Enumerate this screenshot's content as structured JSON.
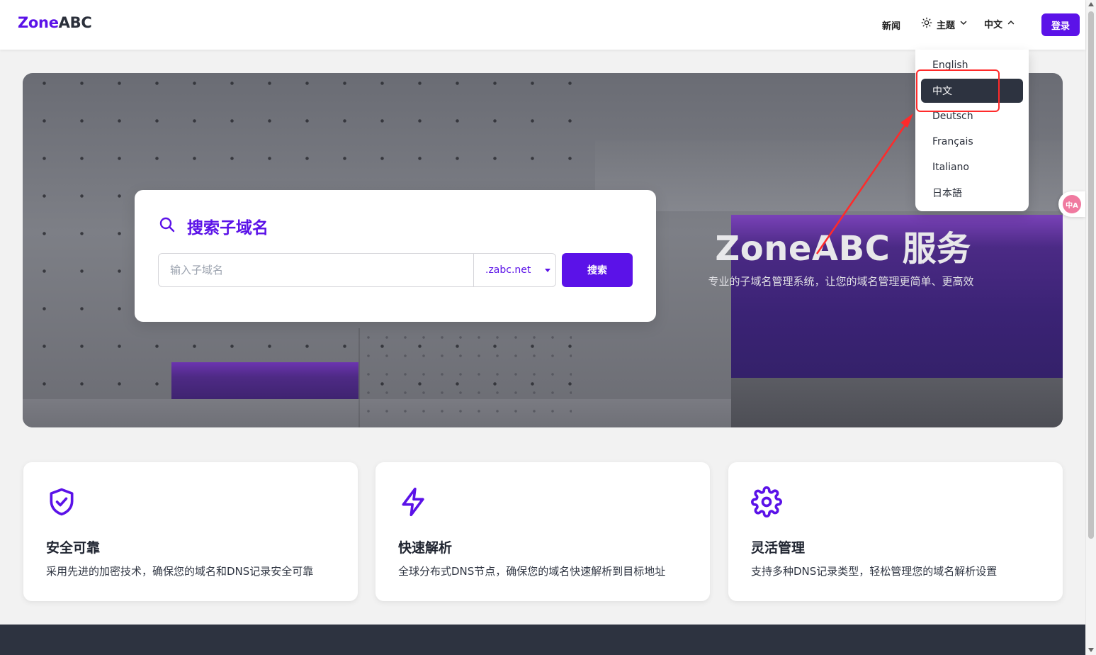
{
  "header": {
    "logo_zone": "Zone",
    "logo_abc": "ABC",
    "news": "新闻",
    "theme": "主题",
    "language": "中文",
    "login": "登录"
  },
  "language_menu": {
    "items": [
      "English",
      "中文",
      "Deutsch",
      "Français",
      "Italiano",
      "日本語"
    ],
    "selected": "中文"
  },
  "hero": {
    "title": "ZoneABC 服务",
    "subtitle": "专业的子域名管理系统，让您的域名管理更简单、更高效"
  },
  "search": {
    "title": "搜索子域名",
    "placeholder": "输入子域名",
    "domain": ".zabc.net",
    "button": "搜索"
  },
  "features": [
    {
      "icon": "shield-check-icon",
      "title": "安全可靠",
      "desc": "采用先进的加密技术，确保您的域名和DNS记录安全可靠"
    },
    {
      "icon": "lightning-icon",
      "title": "快速解析",
      "desc": "全球分布式DNS节点，确保您的域名快速解析到目标地址"
    },
    {
      "icon": "gear-icon",
      "title": "灵活管理",
      "desc": "支持多种DNS记录类型，轻松管理您的域名解析设置"
    }
  ],
  "translate_widget": "中A",
  "colors": {
    "brand": "#5b12e8",
    "dark": "#2d3340",
    "annotation": "#ff2a2a"
  }
}
